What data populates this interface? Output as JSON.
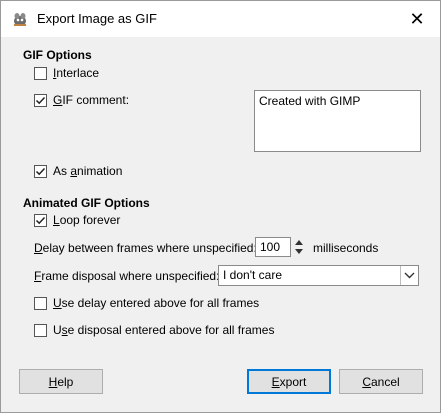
{
  "window": {
    "title": "Export Image as GIF",
    "close_glyph": "✕"
  },
  "gif_options": {
    "heading": "GIF Options",
    "interlace": {
      "label_u": "I",
      "label_rest": "nterlace",
      "checked": false
    },
    "gif_comment": {
      "label_u": "G",
      "label_rest": "IF comment:",
      "checked": true,
      "value": "Created with GIMP"
    },
    "as_animation": {
      "label_pre": "As ",
      "label_u": "a",
      "label_rest": "nimation",
      "checked": true
    }
  },
  "animated_options": {
    "heading": "Animated GIF Options",
    "loop_forever": {
      "label_u": "L",
      "label_rest": "oop forever",
      "checked": true
    },
    "delay": {
      "label_u": "D",
      "label_rest": "elay between frames where unspecified:",
      "value": "100",
      "unit": "milliseconds"
    },
    "disposal": {
      "label_u": "F",
      "label_rest": "rame disposal where unspecified:",
      "value": "I don't care"
    },
    "use_delay": {
      "label_u": "U",
      "label_rest": "se delay entered above for all frames",
      "checked": false
    },
    "use_disposal": {
      "label_pre": "U",
      "label_u": "s",
      "label_rest": "e disposal entered above for all frames",
      "checked": false
    }
  },
  "buttons": {
    "help": {
      "label_u": "H",
      "label_rest": "elp"
    },
    "export": {
      "label_u": "E",
      "label_rest": "xport"
    },
    "cancel": {
      "label_u": "C",
      "label_rest": "ancel"
    }
  },
  "colors": {
    "accent": "#0078d7",
    "dialog_bg": "#f0f0f0"
  }
}
